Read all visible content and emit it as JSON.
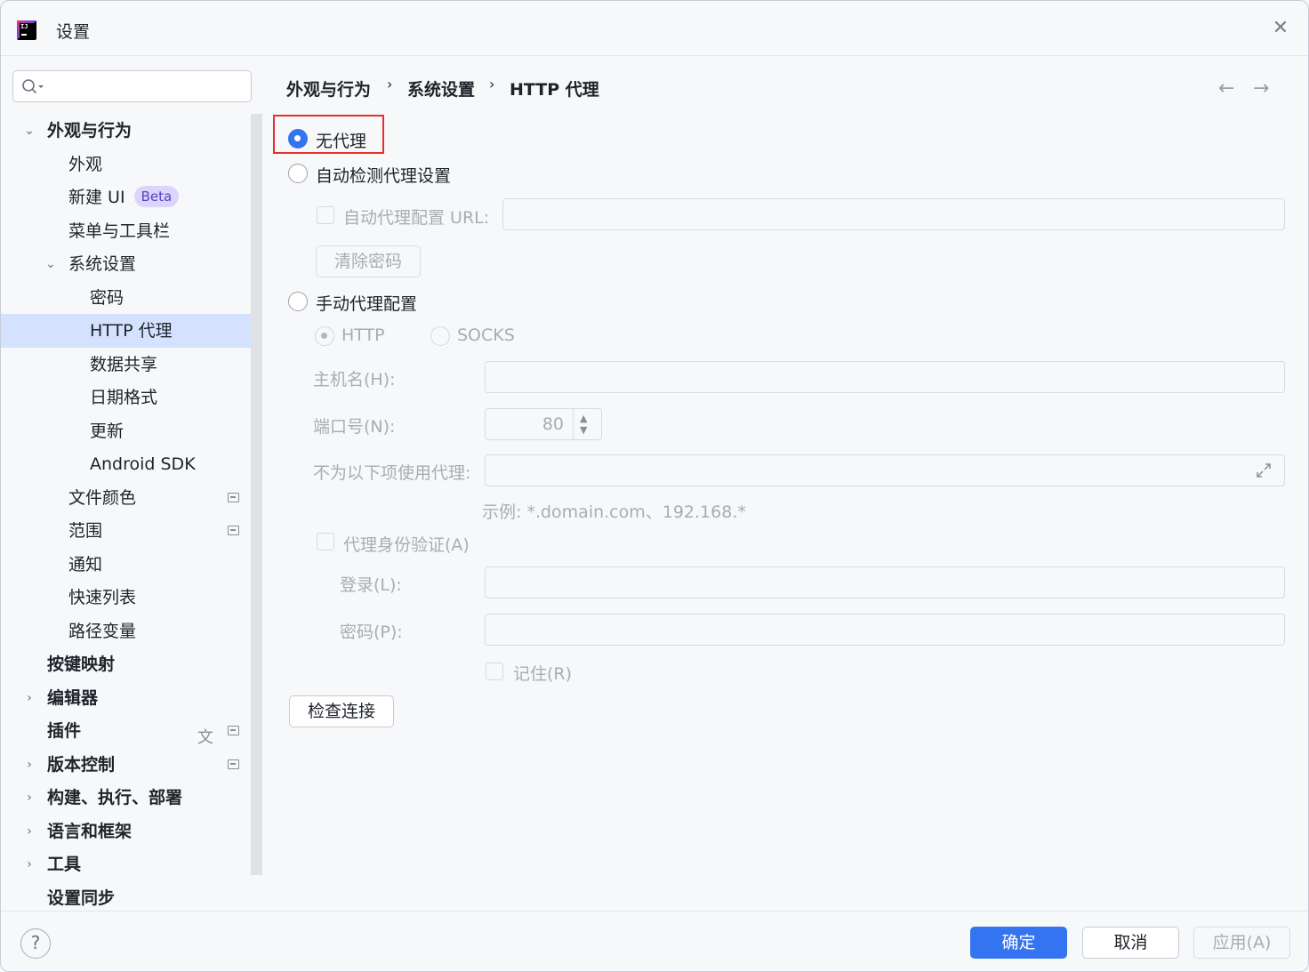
{
  "window": {
    "title": "设置"
  },
  "sidebar": {
    "search": {
      "placeholder": ""
    },
    "items": [
      {
        "label": "外观与行为",
        "expanded": true
      },
      {
        "label": "外观"
      },
      {
        "label": "新建 UI",
        "badge": "Beta"
      },
      {
        "label": "菜单与工具栏"
      },
      {
        "label": "系统设置",
        "expanded": true
      },
      {
        "label": "密码"
      },
      {
        "label": "HTTP 代理",
        "selected": true
      },
      {
        "label": "数据共享"
      },
      {
        "label": "日期格式"
      },
      {
        "label": "更新"
      },
      {
        "label": "Android SDK"
      },
      {
        "label": "文件颜色"
      },
      {
        "label": "范围"
      },
      {
        "label": "通知"
      },
      {
        "label": "快速列表"
      },
      {
        "label": "路径变量"
      },
      {
        "label": "按键映射"
      },
      {
        "label": "编辑器",
        "expanded": false
      },
      {
        "label": "插件"
      },
      {
        "label": "版本控制",
        "expanded": false
      },
      {
        "label": "构建、执行、部署",
        "expanded": false
      },
      {
        "label": "语言和框架",
        "expanded": false
      },
      {
        "label": "工具",
        "expanded": false
      },
      {
        "label": "设置同步"
      }
    ]
  },
  "breadcrumb": [
    "外观与行为",
    "系统设置",
    "HTTP 代理"
  ],
  "proxy": {
    "no_proxy": "无代理",
    "auto_detect": "自动检测代理设置",
    "auto_config_url_label": "自动代理配置 URL:",
    "clear_password_button": "清除密码",
    "manual": "手动代理配置",
    "http": "HTTP",
    "socks": "SOCKS",
    "host_label": "主机名(H):",
    "port_label": "端口号(N):",
    "port_value": "80",
    "no_proxy_for_label": "不为以下项使用代理:",
    "example": "示例: *.domain.com、192.168.*",
    "auth_label": "代理身份验证(A)",
    "login_label": "登录(L):",
    "password_label": "密码(P):",
    "remember_label": "记住(R)",
    "check_connection_button": "检查连接",
    "selected_mode": "no_proxy"
  },
  "footer": {
    "help": "?",
    "ok": "确定",
    "cancel": "取消",
    "apply": "应用(A)"
  },
  "colors": {
    "accent": "#3574f0",
    "selection": "#d4e2ff",
    "highlight_box": "#e5302b"
  }
}
